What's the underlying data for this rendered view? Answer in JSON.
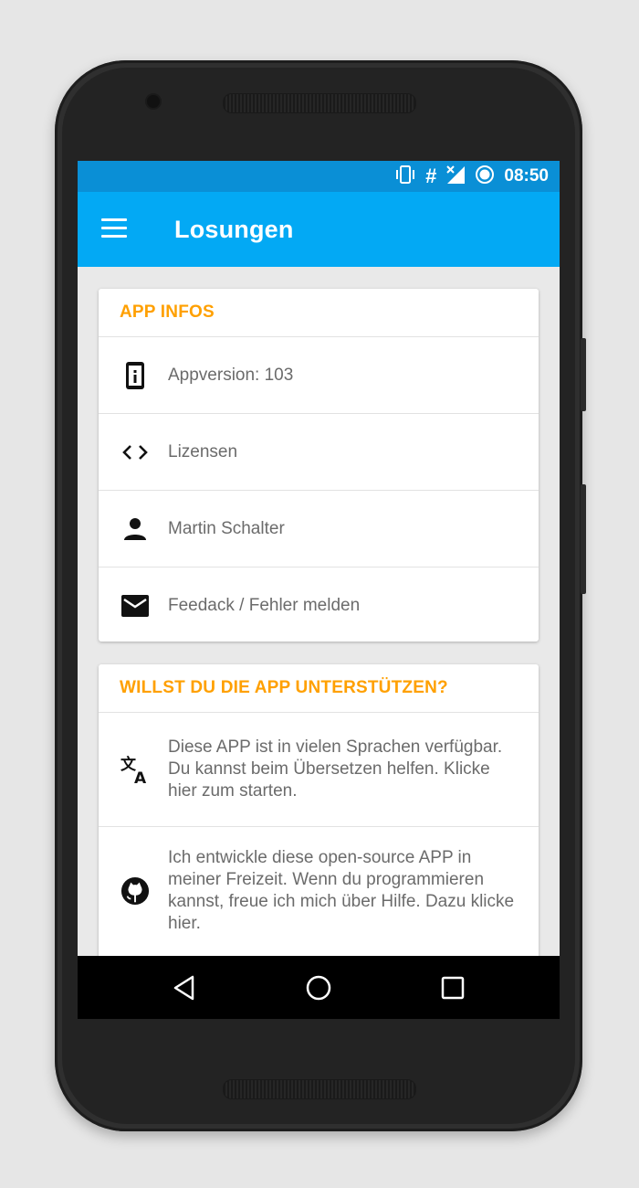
{
  "status_bar": {
    "time": "08:50",
    "icons": [
      "vibrate-icon",
      "hash-icon",
      "no-signal-icon",
      "data-saver-icon"
    ],
    "hash_glyph": "#"
  },
  "app_bar": {
    "title": "Losungen",
    "menu_icon": "hamburger-menu-icon",
    "color": "#03a9f4"
  },
  "sections": [
    {
      "header": "APP INFOS",
      "items": [
        {
          "icon": "phone-info-icon",
          "label": "Appversion: 103"
        },
        {
          "icon": "code-icon",
          "label": "Lizensen"
        },
        {
          "icon": "person-icon",
          "label": "Martin Schalter"
        },
        {
          "icon": "mail-icon",
          "label": "Feedack / Fehler melden"
        }
      ]
    },
    {
      "header": "WILLST DU DIE APP UNTERSTÜTZEN?",
      "items": [
        {
          "icon": "translate-icon",
          "label": "Diese APP ist in vielen Sprachen verfügbar. Du kannst beim Übersetzen helfen. Klicke hier zum starten."
        },
        {
          "icon": "github-icon",
          "label": "Ich entwickle diese open-source APP in meiner Freizeit. Wenn du programmieren kannst, freue ich mich über Hilfe. Dazu klicke hier."
        }
      ]
    }
  ],
  "colors": {
    "accent": "#ffa000",
    "status_bar": "#0a8fd6",
    "text": "#6b6b6b"
  },
  "nav_bar": {
    "buttons": [
      "back-icon",
      "home-icon",
      "recents-icon"
    ]
  }
}
